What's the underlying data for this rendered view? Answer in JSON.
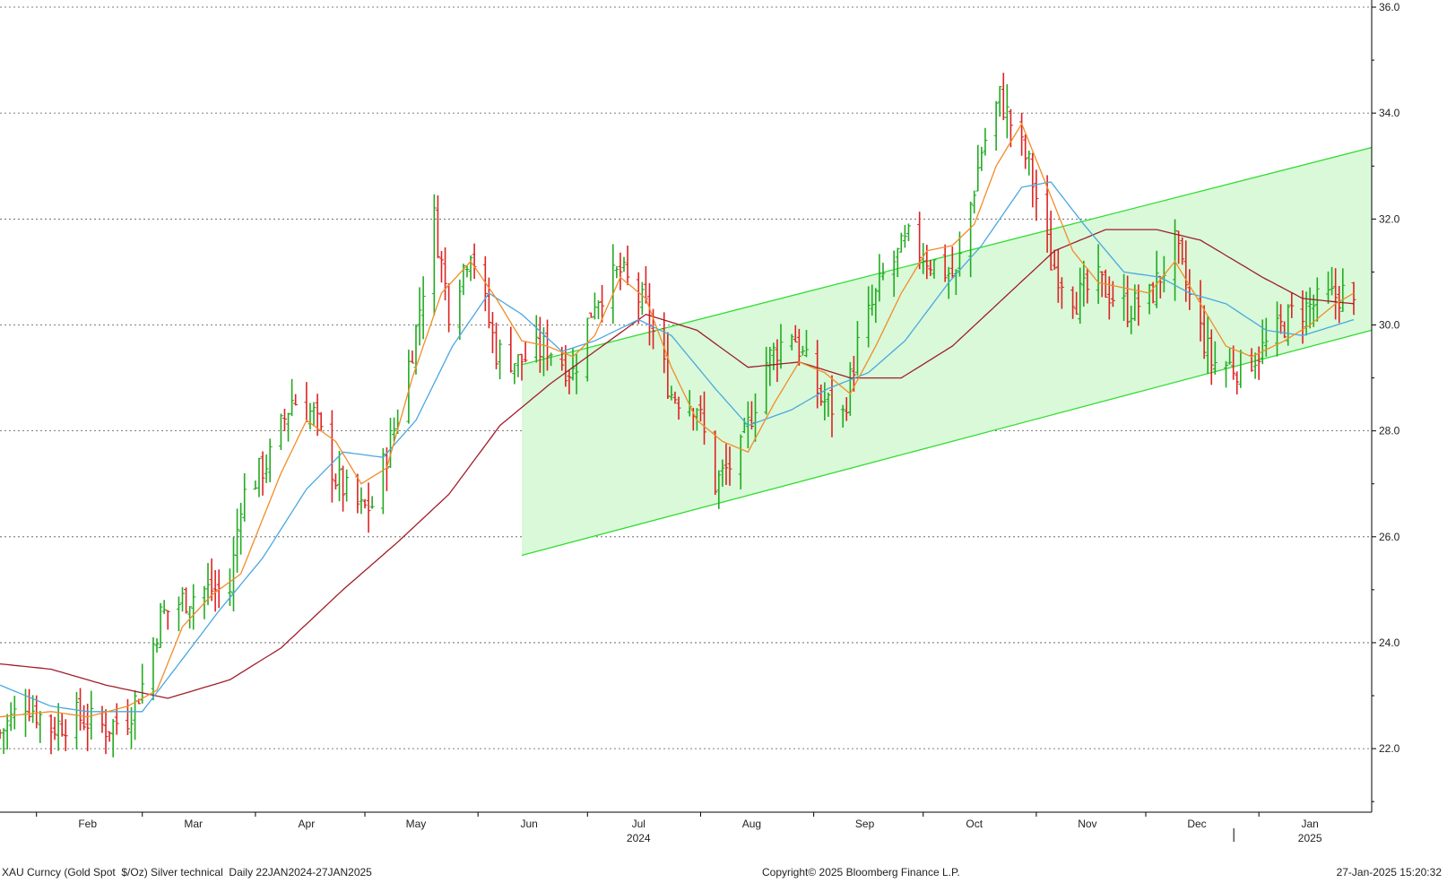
{
  "footer": {
    "left": "XAU Curncy (Gold Spot  $/Oz) Silver technical  Daily 22JAN2024-27JAN2025",
    "center": "Copyright© 2025 Bloomberg Finance L.P.",
    "right": "27-Jan-2025 15:20:32"
  },
  "chart_data": {
    "type": "ohlc-bar",
    "ylim": [
      20.8,
      36.0
    ],
    "yticks": [
      "22.0",
      "24.0",
      "26.0",
      "28.0",
      "30.0",
      "32.0",
      "34.0",
      "36.0"
    ],
    "x_range": [
      "2024-01-22",
      "2025-01-27"
    ],
    "xticks": [
      {
        "label": "Feb",
        "date": "2024-02-15"
      },
      {
        "label": "Mar",
        "date": "2024-03-15"
      },
      {
        "label": "Apr",
        "date": "2024-04-15"
      },
      {
        "label": "May",
        "date": "2024-05-15"
      },
      {
        "label": "Jun",
        "date": "2024-06-15"
      },
      {
        "label": "Jul",
        "date": "2024-07-15"
      },
      {
        "label": "Aug",
        "date": "2024-08-15"
      },
      {
        "label": "Sep",
        "date": "2024-09-15"
      },
      {
        "label": "Oct",
        "date": "2024-10-15"
      },
      {
        "label": "Nov",
        "date": "2024-11-15"
      },
      {
        "label": "Dec",
        "date": "2024-12-15"
      },
      {
        "label": "Jan",
        "date": "2025-01-15"
      }
    ],
    "year_labels": [
      {
        "label": "2024",
        "date": "2024-07-15"
      },
      {
        "label": "2025",
        "date": "2025-01-15"
      }
    ],
    "grid": "horizontal dotted",
    "colors": {
      "up": "#22aa22",
      "down": "#dd2222",
      "ma_fast": "#f28c28",
      "ma_mid": "#4aa8e0",
      "ma_slow": "#a01e2a",
      "channel": "#33dd33",
      "channel_fill": "#d9f9d9"
    },
    "channel": {
      "start_date": "2024-06-13",
      "end_date": "2025-01-27",
      "upper": [
        29.25,
        33.35
      ],
      "lower": [
        25.65,
        29.9
      ]
    },
    "close_anchors": [
      [
        "2024-01-22",
        22.3
      ],
      [
        "2024-01-29",
        22.9
      ],
      [
        "2024-02-05",
        22.4
      ],
      [
        "2024-02-12",
        22.6
      ],
      [
        "2024-02-20",
        22.4
      ],
      [
        "2024-02-26",
        22.6
      ],
      [
        "2024-03-01",
        23.2
      ],
      [
        "2024-03-06",
        24.5
      ],
      [
        "2024-03-12",
        24.8
      ],
      [
        "2024-03-18",
        25.0
      ],
      [
        "2024-03-25",
        25.0
      ],
      [
        "2024-03-28",
        26.7
      ],
      [
        "2024-04-05",
        27.5
      ],
      [
        "2024-04-11",
        28.6
      ],
      [
        "2024-04-17",
        28.3
      ],
      [
        "2024-04-23",
        27.1
      ],
      [
        "2024-04-30",
        26.5
      ],
      [
        "2024-05-03",
        26.6
      ],
      [
        "2024-05-10",
        28.3
      ],
      [
        "2024-05-15",
        29.9
      ],
      [
        "2024-05-20",
        32.0
      ],
      [
        "2024-05-24",
        30.3
      ],
      [
        "2024-05-30",
        31.5
      ],
      [
        "2024-06-06",
        29.5
      ],
      [
        "2024-06-12",
        29.3
      ],
      [
        "2024-06-20",
        29.6
      ],
      [
        "2024-06-27",
        29.1
      ],
      [
        "2024-07-03",
        30.5
      ],
      [
        "2024-07-10",
        31.0
      ],
      [
        "2024-07-17",
        30.3
      ],
      [
        "2024-07-24",
        28.7
      ],
      [
        "2024-07-31",
        28.5
      ],
      [
        "2024-08-05",
        27.0
      ],
      [
        "2024-08-12",
        27.6
      ],
      [
        "2024-08-19",
        29.3
      ],
      [
        "2024-08-26",
        29.9
      ],
      [
        "2024-09-03",
        28.6
      ],
      [
        "2024-09-09",
        28.3
      ],
      [
        "2024-09-13",
        29.6
      ],
      [
        "2024-09-20",
        30.9
      ],
      [
        "2024-09-27",
        31.6
      ],
      [
        "2024-10-03",
        31.2
      ],
      [
        "2024-10-10",
        30.9
      ],
      [
        "2024-10-17",
        33.3
      ],
      [
        "2024-10-22",
        34.3
      ],
      [
        "2024-10-30",
        33.0
      ],
      [
        "2024-11-05",
        31.2
      ],
      [
        "2024-11-12",
        30.5
      ],
      [
        "2024-11-18",
        30.8
      ],
      [
        "2024-11-26",
        30.3
      ],
      [
        "2024-12-02",
        30.5
      ],
      [
        "2024-12-09",
        31.5
      ],
      [
        "2024-12-13",
        30.5
      ],
      [
        "2024-12-19",
        29.3
      ],
      [
        "2024-12-27",
        29.2
      ],
      [
        "2025-01-03",
        29.6
      ],
      [
        "2025-01-10",
        30.2
      ],
      [
        "2025-01-17",
        30.4
      ],
      [
        "2025-01-24",
        30.6
      ],
      [
        "2025-01-27",
        30.3
      ]
    ],
    "ma_fast_anchors": [
      [
        "2024-01-22",
        22.6
      ],
      [
        "2024-02-05",
        22.7
      ],
      [
        "2024-02-15",
        22.6
      ],
      [
        "2024-02-26",
        22.8
      ],
      [
        "2024-03-05",
        23.1
      ],
      [
        "2024-03-12",
        24.3
      ],
      [
        "2024-03-20",
        24.9
      ],
      [
        "2024-03-28",
        25.3
      ],
      [
        "2024-04-08",
        27.2
      ],
      [
        "2024-04-15",
        28.2
      ],
      [
        "2024-04-23",
        27.8
      ],
      [
        "2024-04-30",
        27.0
      ],
      [
        "2024-05-07",
        27.3
      ],
      [
        "2024-05-14",
        29.0
      ],
      [
        "2024-05-22",
        30.6
      ],
      [
        "2024-05-30",
        31.2
      ],
      [
        "2024-06-06",
        30.5
      ],
      [
        "2024-06-13",
        29.7
      ],
      [
        "2024-06-20",
        29.6
      ],
      [
        "2024-06-27",
        29.4
      ],
      [
        "2024-07-03",
        29.8
      ],
      [
        "2024-07-10",
        30.9
      ],
      [
        "2024-07-17",
        30.5
      ],
      [
        "2024-07-24",
        29.2
      ],
      [
        "2024-07-31",
        28.2
      ],
      [
        "2024-08-07",
        27.8
      ],
      [
        "2024-08-14",
        27.6
      ],
      [
        "2024-08-21",
        28.5
      ],
      [
        "2024-08-28",
        29.3
      ],
      [
        "2024-09-04",
        29.1
      ],
      [
        "2024-09-11",
        28.7
      ],
      [
        "2024-09-18",
        29.6
      ],
      [
        "2024-09-25",
        30.6
      ],
      [
        "2024-10-02",
        31.4
      ],
      [
        "2024-10-09",
        31.5
      ],
      [
        "2024-10-15",
        31.9
      ],
      [
        "2024-10-21",
        33.0
      ],
      [
        "2024-10-28",
        33.8
      ],
      [
        "2024-11-04",
        32.6
      ],
      [
        "2024-11-11",
        31.4
      ],
      [
        "2024-11-18",
        30.8
      ],
      [
        "2024-11-25",
        30.7
      ],
      [
        "2024-12-02",
        30.6
      ],
      [
        "2024-12-09",
        31.2
      ],
      [
        "2024-12-16",
        30.4
      ],
      [
        "2024-12-23",
        29.6
      ],
      [
        "2024-12-30",
        29.4
      ],
      [
        "2025-01-08",
        29.7
      ],
      [
        "2025-01-15",
        30.0
      ],
      [
        "2025-01-22",
        30.4
      ],
      [
        "2025-01-27",
        30.6
      ]
    ],
    "ma_mid_anchors": [
      [
        "2024-01-22",
        23.2
      ],
      [
        "2024-02-05",
        22.8
      ],
      [
        "2024-02-15",
        22.7
      ],
      [
        "2024-03-01",
        22.7
      ],
      [
        "2024-03-11",
        23.6
      ],
      [
        "2024-03-22",
        24.6
      ],
      [
        "2024-04-03",
        25.6
      ],
      [
        "2024-04-15",
        26.9
      ],
      [
        "2024-04-25",
        27.6
      ],
      [
        "2024-05-06",
        27.5
      ],
      [
        "2024-05-15",
        28.2
      ],
      [
        "2024-05-25",
        29.6
      ],
      [
        "2024-06-04",
        30.6
      ],
      [
        "2024-06-13",
        30.2
      ],
      [
        "2024-06-24",
        29.5
      ],
      [
        "2024-07-03",
        29.7
      ],
      [
        "2024-07-15",
        30.1
      ],
      [
        "2024-07-24",
        29.8
      ],
      [
        "2024-08-05",
        28.8
      ],
      [
        "2024-08-14",
        28.1
      ],
      [
        "2024-08-26",
        28.4
      ],
      [
        "2024-09-05",
        28.8
      ],
      [
        "2024-09-16",
        29.1
      ],
      [
        "2024-09-26",
        29.7
      ],
      [
        "2024-10-08",
        30.8
      ],
      [
        "2024-10-17",
        31.5
      ],
      [
        "2024-10-28",
        32.6
      ],
      [
        "2024-11-05",
        32.7
      ],
      [
        "2024-11-14",
        31.9
      ],
      [
        "2024-11-25",
        31.0
      ],
      [
        "2024-12-05",
        30.9
      ],
      [
        "2024-12-13",
        30.6
      ],
      [
        "2024-12-23",
        30.4
      ],
      [
        "2025-01-03",
        29.9
      ],
      [
        "2025-01-13",
        29.8
      ],
      [
        "2025-01-27",
        30.1
      ]
    ],
    "ma_slow_anchors": [
      [
        "2024-01-22",
        23.6
      ],
      [
        "2024-02-05",
        23.5
      ],
      [
        "2024-02-20",
        23.2
      ],
      [
        "2024-03-08",
        22.95
      ],
      [
        "2024-03-25",
        23.3
      ],
      [
        "2024-04-08",
        23.9
      ],
      [
        "2024-04-25",
        25.0
      ],
      [
        "2024-05-10",
        25.9
      ],
      [
        "2024-05-24",
        26.8
      ],
      [
        "2024-06-07",
        28.1
      ],
      [
        "2024-06-21",
        28.9
      ],
      [
        "2024-07-03",
        29.5
      ],
      [
        "2024-07-17",
        30.2
      ],
      [
        "2024-07-31",
        29.9
      ],
      [
        "2024-08-14",
        29.2
      ],
      [
        "2024-08-28",
        29.3
      ],
      [
        "2024-09-11",
        29.0
      ],
      [
        "2024-09-25",
        29.0
      ],
      [
        "2024-10-09",
        29.6
      ],
      [
        "2024-10-23",
        30.5
      ],
      [
        "2024-11-06",
        31.4
      ],
      [
        "2024-11-20",
        31.8
      ],
      [
        "2024-12-04",
        31.8
      ],
      [
        "2024-12-16",
        31.6
      ],
      [
        "2025-01-02",
        30.9
      ],
      [
        "2025-01-13",
        30.5
      ],
      [
        "2025-01-27",
        30.4
      ]
    ],
    "bar_range_seed": 7
  }
}
